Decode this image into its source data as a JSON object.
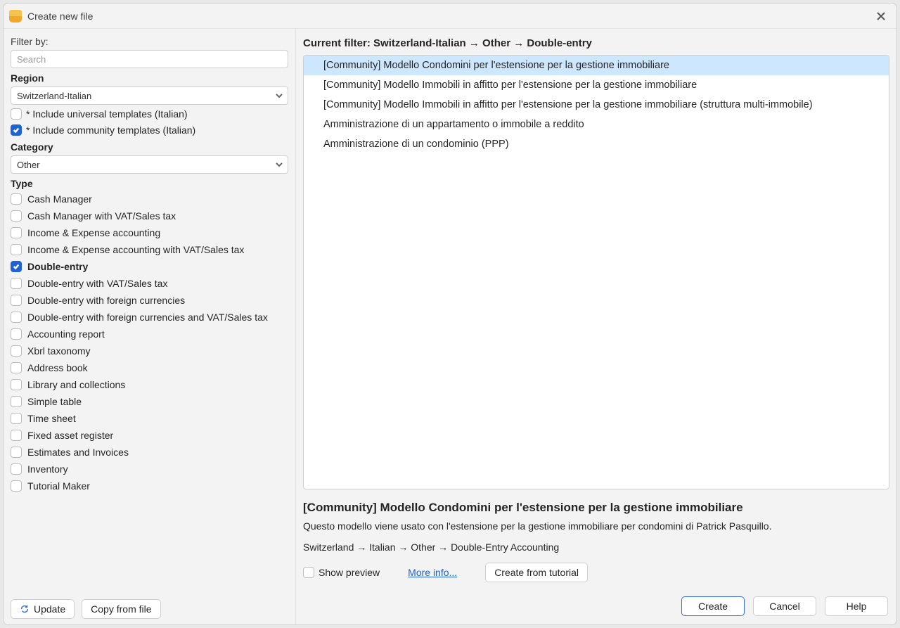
{
  "window": {
    "title": "Create new file"
  },
  "sidebar": {
    "filter_by_label": "Filter by:",
    "search_placeholder": "Search",
    "region_heading": "Region",
    "region_selected": "Switzerland-Italian",
    "include_universal": {
      "label": "* Include universal templates (Italian)",
      "checked": false
    },
    "include_community": {
      "label": "* Include community templates (Italian)",
      "checked": true
    },
    "category_heading": "Category",
    "category_selected": "Other",
    "type_heading": "Type",
    "types": [
      {
        "label": "Cash Manager",
        "checked": false
      },
      {
        "label": "Cash Manager with VAT/Sales tax",
        "checked": false
      },
      {
        "label": "Income & Expense accounting",
        "checked": false
      },
      {
        "label": "Income & Expense accounting with VAT/Sales tax",
        "checked": false
      },
      {
        "label": "Double-entry",
        "checked": true
      },
      {
        "label": "Double-entry with VAT/Sales tax",
        "checked": false
      },
      {
        "label": "Double-entry with foreign currencies",
        "checked": false
      },
      {
        "label": "Double-entry with foreign currencies and VAT/Sales tax",
        "checked": false
      },
      {
        "label": "Accounting report",
        "checked": false
      },
      {
        "label": "Xbrl taxonomy",
        "checked": false
      },
      {
        "label": "Address book",
        "checked": false
      },
      {
        "label": "Library and collections",
        "checked": false
      },
      {
        "label": "Simple table",
        "checked": false
      },
      {
        "label": "Time sheet",
        "checked": false
      },
      {
        "label": "Fixed asset register",
        "checked": false
      },
      {
        "label": "Estimates and Invoices",
        "checked": false
      },
      {
        "label": "Inventory",
        "checked": false
      },
      {
        "label": "Tutorial Maker",
        "checked": false
      }
    ],
    "update_label": "Update",
    "copy_from_file_label": "Copy from file"
  },
  "main": {
    "filter_prefix": "Current filter: ",
    "filter_value": "Switzerland-Italian → Other → Double-entry",
    "templates": [
      {
        "label": "[Community] Modello Condomini per l'estensione per la gestione immobiliare",
        "selected": true
      },
      {
        "label": "[Community] Modello Immobili in affitto per l'estensione per la gestione immobiliare",
        "selected": false
      },
      {
        "label": "[Community] Modello Immobili in affitto per l'estensione per la gestione immobiliare (struttura multi-immobile)",
        "selected": false
      },
      {
        "label": "Amministrazione di un appartamento o immobile a reddito",
        "selected": false
      },
      {
        "label": "Amministrazione di un condominio (PPP)",
        "selected": false
      }
    ],
    "detail": {
      "title": "[Community] Modello Condomini per l'estensione per la gestione immobiliare",
      "description": "Questo modello viene usato con l'estensione per la gestione immobiliare per condomini di Patrick Pasquillo.",
      "path": "Switzerland → Italian → Other → Double-Entry Accounting",
      "show_preview_label": "Show preview",
      "more_info_label": "More info...",
      "create_from_tutorial_label": "Create from tutorial"
    }
  },
  "footer": {
    "create_label": "Create",
    "cancel_label": "Cancel",
    "help_label": "Help"
  }
}
